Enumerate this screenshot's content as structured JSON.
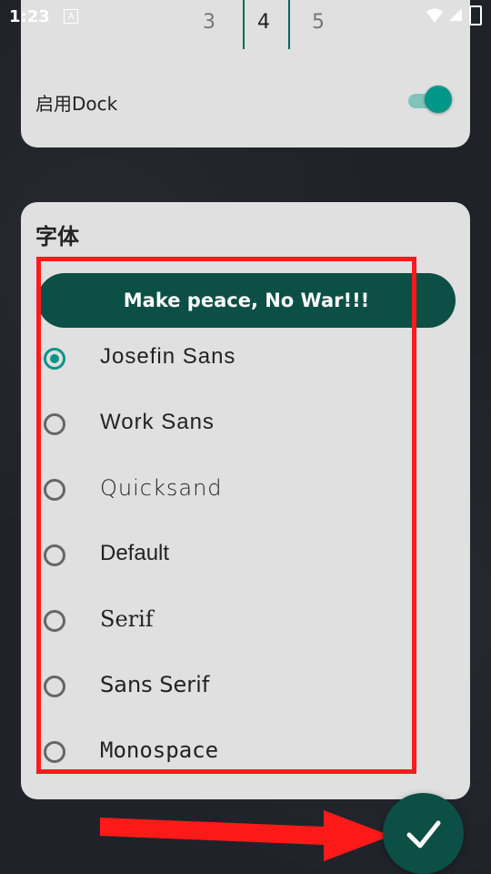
{
  "status": {
    "time": "1:23",
    "note_icon": "A"
  },
  "top_card": {
    "picker_values": [
      "3",
      "4",
      "5"
    ],
    "dock_label": "启用Dock",
    "dock_enabled": true
  },
  "font_card": {
    "title": "字体",
    "preview_text": "Make peace, No War!!!",
    "options": [
      {
        "label": "Josefin Sans",
        "selected": true
      },
      {
        "label": "Work Sans",
        "selected": false
      },
      {
        "label": "Quicksand",
        "selected": false
      },
      {
        "label": "Default",
        "selected": false
      },
      {
        "label": "Serif",
        "selected": false
      },
      {
        "label": "Sans Serif",
        "selected": false
      },
      {
        "label": "Monospace",
        "selected": false
      }
    ]
  },
  "colors": {
    "accent": "#009688",
    "preview_bg": "#0b4f45",
    "highlight": "#ff1a1a"
  }
}
